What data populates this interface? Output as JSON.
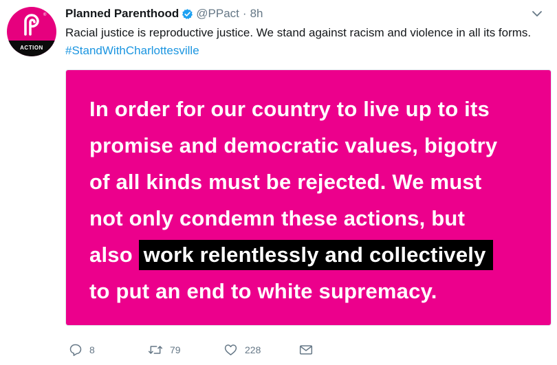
{
  "account": {
    "name": "Planned Parenthood",
    "handle": "@PPact",
    "separator": "·",
    "time": "8h",
    "avatar_label": "ACTION",
    "registered_mark": "®",
    "verified_icon": "verified-badge-icon"
  },
  "tweet": {
    "text": "Racial justice is reproductive justice. We stand against racism and violence in all its forms.",
    "hashtag": "#StandWithCharlottesville"
  },
  "media": {
    "background": "#ec008c",
    "lines": [
      "In order for our country to live up to its",
      "promise and democratic values, bigotry",
      "of all kinds must be rejected. We must",
      "not only condemn these actions, but"
    ],
    "line5_prefix": "also ",
    "line5_highlight": "work relentlessly and collectively",
    "line6": "to put an end to white supremacy."
  },
  "actions": {
    "reply_count": "8",
    "retweet_count": "79",
    "like_count": "228"
  },
  "colors": {
    "brand_pink": "#ec008c",
    "link_blue": "#1b95e0",
    "muted_gray": "#657786",
    "verified_blue": "#1da1f2"
  }
}
